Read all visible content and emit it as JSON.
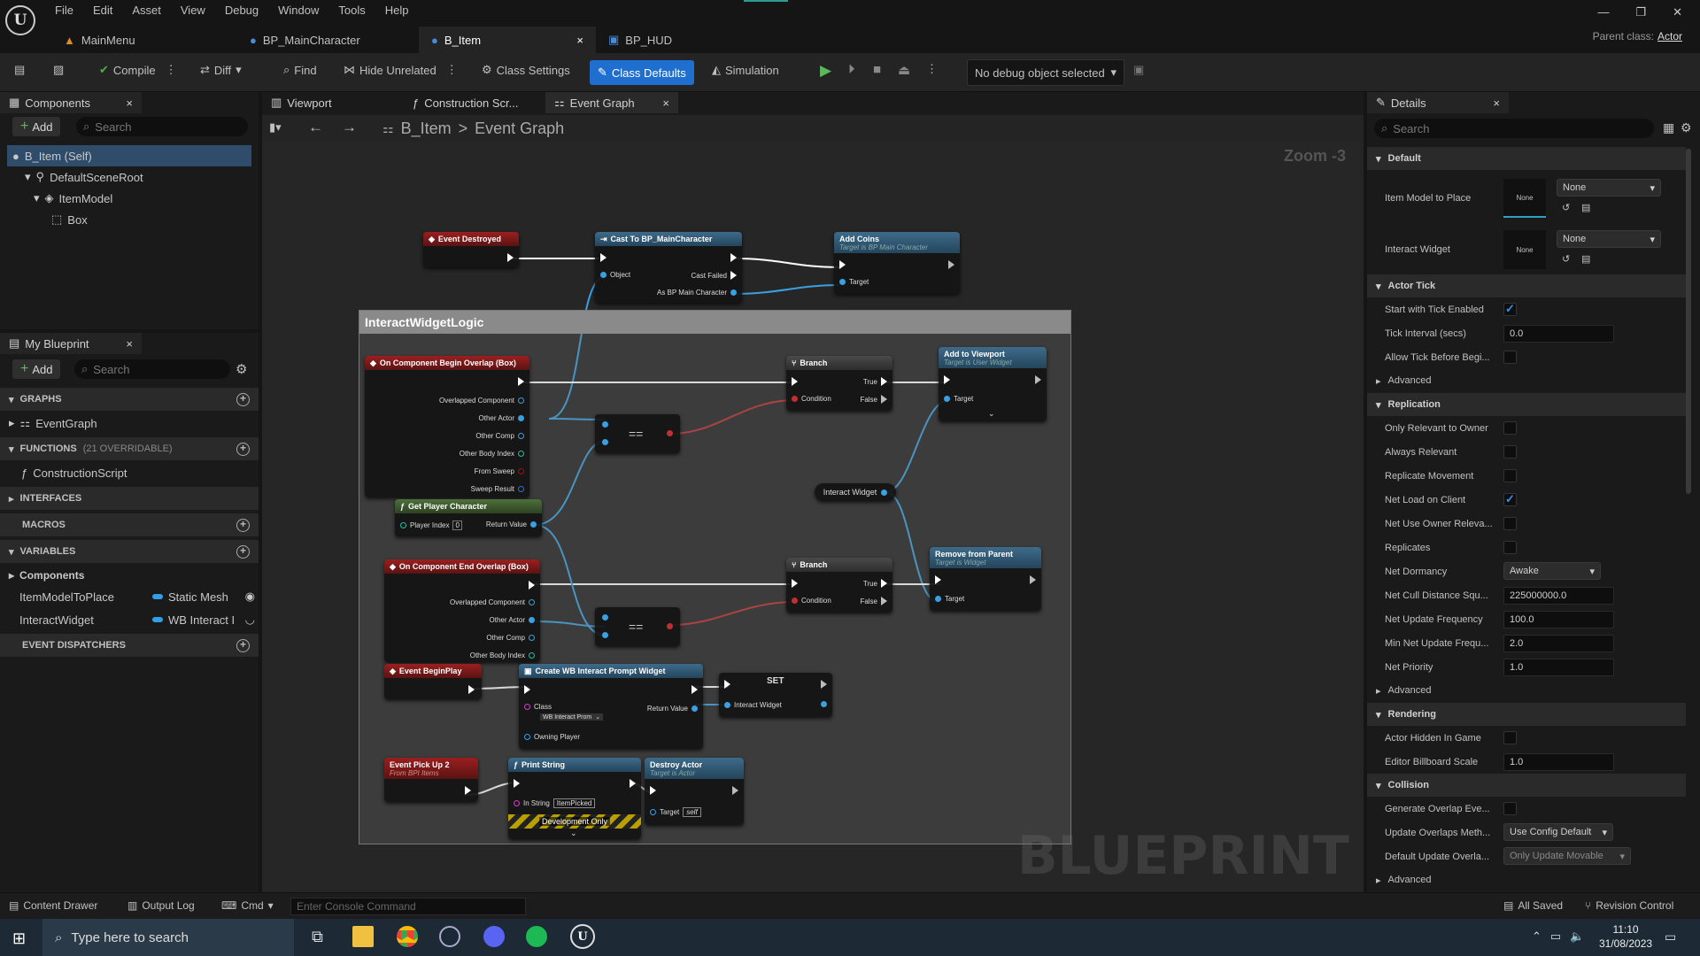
{
  "menu": [
    "File",
    "Edit",
    "Asset",
    "View",
    "Debug",
    "Window",
    "Tools",
    "Help"
  ],
  "window_controls": [
    "—",
    "❐",
    "✕"
  ],
  "doc_tabs": [
    {
      "label": "MainMenu",
      "active": false
    },
    {
      "label": "BP_MainCharacter",
      "active": false
    },
    {
      "label": "B_Item",
      "active": true,
      "close": "×"
    },
    {
      "label": "BP_HUD",
      "active": false
    }
  ],
  "parent_class": {
    "label": "Parent class:",
    "value": "Actor"
  },
  "toolbar": {
    "compile": "Compile",
    "diff": "Diff",
    "find": "Find",
    "hide_unrelated": "Hide Unrelated",
    "class_settings": "Class Settings",
    "class_defaults": "Class Defaults",
    "simulation": "Simulation",
    "debug_object": "No debug object selected"
  },
  "components": {
    "tab": "Components",
    "add": "Add",
    "search_placeholder": "Search",
    "items": [
      {
        "label": "B_Item (Self)",
        "indent": 0,
        "selected": true
      },
      {
        "label": "DefaultSceneRoot",
        "indent": 1
      },
      {
        "label": "ItemModel",
        "indent": 2
      },
      {
        "label": "Box",
        "indent": 3
      }
    ]
  },
  "my_blueprint": {
    "tab": "My Blueprint",
    "add": "Add",
    "search_placeholder": "Search",
    "graphs": "GRAPHS",
    "event_graph": "EventGraph",
    "functions": "FUNCTIONS",
    "functions_note": "(21 OVERRIDABLE)",
    "construction_script": "ConstructionScript",
    "interfaces": "INTERFACES",
    "macros": "MACROS",
    "variables": "VARIABLES",
    "components_cat": "Components",
    "vars": [
      {
        "name": "ItemModelToPlace",
        "type": "Static Mesh"
      },
      {
        "name": "InteractWidget",
        "type": "WB Interact I"
      }
    ],
    "event_dispatchers": "EVENT DISPATCHERS"
  },
  "graph_tabs": [
    {
      "label": "Viewport"
    },
    {
      "label": "Construction Scr..."
    },
    {
      "label": "Event Graph",
      "active": true,
      "close": "×"
    }
  ],
  "breadcrumb": {
    "root": "B_Item",
    "sep": ">",
    "leaf": "Event Graph"
  },
  "zoom": "Zoom -3",
  "watermark": "BLUEPRINT",
  "comment_title": "InteractWidgetLogic",
  "nodes": {
    "event_destroyed": "Event Destroyed",
    "cast": "Cast To BP_MainCharacter",
    "cast_object": "Object",
    "cast_failed": "Cast Failed",
    "cast_as": "As BP Main Character",
    "add_coins": "Add Coins",
    "add_coins_sub": "Target is BP Main Character",
    "target": "Target",
    "begin_overlap": "On Component Begin Overlap (Box)",
    "overlapped_component": "Overlapped Component",
    "other_actor": "Other Actor",
    "other_comp": "Other Comp",
    "other_body_index": "Other Body Index",
    "from_sweep": "From Sweep",
    "sweep_result": "Sweep Result",
    "get_player_character": "Get Player Character",
    "player_index": "Player Index",
    "player_index_val": "0",
    "return_value": "Return Value",
    "eq": "==",
    "branch": "Branch",
    "true": "True",
    "false": "False",
    "condition": "Condition",
    "add_to_viewport": "Add to Viewport",
    "add_to_viewport_sub": "Target is User Widget",
    "interact_widget": "Interact Widget",
    "remove_from_parent": "Remove from Parent",
    "remove_sub": "Target is Widget",
    "end_overlap": "On Component End Overlap (Box)",
    "event_beginplay": "Event BeginPlay",
    "create_widget": "Create WB Interact Prompt Widget",
    "class": "Class",
    "class_val": "WB Interact Prom",
    "owning_player": "Owning Player",
    "set": "SET",
    "event_pickup": "Event Pick Up 2",
    "event_pickup_sub": "From BPI Items",
    "print_string": "Print String",
    "in_string": "In String",
    "in_string_val": "ItemPicked",
    "dev_only": "Development Only",
    "destroy_actor": "Destroy Actor",
    "destroy_sub": "Target is Actor",
    "self": "self"
  },
  "details": {
    "tab": "Details",
    "search_placeholder": "Search",
    "default": "Default",
    "item_model_to_place": "Item Model to Place",
    "none": "None",
    "interact_widget": "Interact Widget",
    "actor_tick": "Actor Tick",
    "start_with_tick": "Start with Tick Enabled",
    "tick_interval": "Tick Interval (secs)",
    "tick_interval_val": "0.0",
    "allow_tick": "Allow Tick Before Begi...",
    "advanced": "Advanced",
    "replication": "Replication",
    "only_relevant": "Only Relevant to Owner",
    "always_relevant": "Always Relevant",
    "replicate_movement": "Replicate Movement",
    "net_load": "Net Load on Client",
    "net_use_owner": "Net Use Owner Releva...",
    "replicates": "Replicates",
    "net_dormancy": "Net Dormancy",
    "net_dormancy_val": "Awake",
    "net_cull": "Net Cull Distance Squ...",
    "net_cull_val": "225000000.0",
    "net_update": "Net Update Frequency",
    "net_update_val": "100.0",
    "min_net_update": "Min Net Update Frequ...",
    "min_net_update_val": "2.0",
    "net_priority": "Net Priority",
    "net_priority_val": "1.0",
    "rendering": "Rendering",
    "actor_hidden": "Actor Hidden In Game",
    "billboard": "Editor Billboard Scale",
    "billboard_val": "1.0",
    "collision": "Collision",
    "gen_overlap": "Generate Overlap Eve...",
    "update_overlaps": "Update Overlaps Meth...",
    "update_overlaps_val": "Use Config Default",
    "default_update": "Default Update Overla...",
    "default_update_val": "Only Update Movable"
  },
  "statusbar": {
    "content_drawer": "Content Drawer",
    "output_log": "Output Log",
    "cmd": "Cmd",
    "console_placeholder": "Enter Console Command",
    "all_saved": "All Saved",
    "revision": "Revision Control"
  },
  "taskbar": {
    "search": "Type here to search",
    "time": "11:10",
    "date": "31/08/2023"
  }
}
